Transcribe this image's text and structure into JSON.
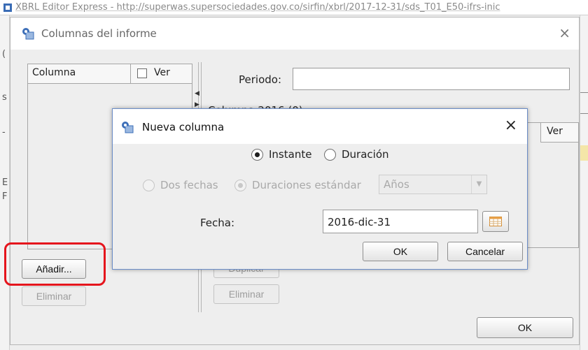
{
  "app": {
    "title": "XBRL Editor Express - http://superwas.supersociedades.gov.co/sirfin/xbrl/2017-12-31/sds_T01_E50-ifrs-inic",
    "icon": "app-icon"
  },
  "main_dialog": {
    "title": "Columnas del informe",
    "close": "×",
    "left_table": {
      "col_header": "Columna",
      "ver_header": "Ver"
    },
    "add_button": "Añadir...",
    "remove_button": "Eliminar",
    "periodo_label": "Periodo:",
    "periodo_value": "",
    "columna_label": "Columna 2016 (0):",
    "right_ver_header": "Ver",
    "right_partial_button": "Duplicar",
    "right_remove_button": "Eliminar",
    "ok_button": "OK"
  },
  "nueva_dialog": {
    "title": "Nueva columna",
    "close": "×",
    "radio_instante": "Instante",
    "radio_duracion": "Duración",
    "selected_type": "Instante",
    "radio_dos_fechas": "Dos fechas",
    "radio_duraciones": "Duraciones estándar",
    "combo_value": "Años",
    "fecha_label": "Fecha:",
    "fecha_value": "2016-dic-31",
    "ok_button": "OK",
    "cancel_button": "Cancelar"
  },
  "colors": {
    "highlight": "#e5151d",
    "dialog_border": "#6a8cc7"
  }
}
